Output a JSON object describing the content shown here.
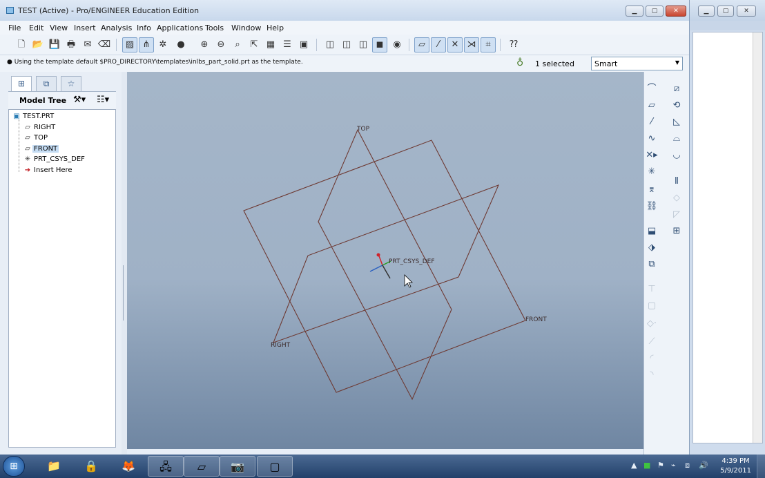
{
  "window": {
    "title": "TEST (Active) - Pro/ENGINEER Education Edition",
    "controls": {
      "minimize": "▁",
      "maximize": "▢",
      "close": "✕"
    }
  },
  "menu": [
    "File",
    "Edit",
    "View",
    "Insert",
    "Analysis",
    "Info",
    "Applications",
    "Tools",
    "Window",
    "Help"
  ],
  "toolbar_icons": [
    "new-icon",
    "open-icon",
    "save-icon",
    "print-icon",
    "send-icon",
    "erase-icon",
    "repaint-icon",
    "datum-display-icon",
    "spin-center-icon",
    "appearance-icon",
    "zoom-in-icon",
    "zoom-out-icon",
    "refit-icon",
    "reorient-icon",
    "saved-views-icon",
    "layers-icon",
    "view-manager-icon",
    "wireframe-icon",
    "hidden-line-icon",
    "no-hidden-icon",
    "shading-icon",
    "enhanced-realism-icon",
    "datum-planes-icon",
    "datum-axes-icon",
    "datum-points-icon",
    "coordinate-systems-icon",
    "annotations-icon",
    "context-help-icon"
  ],
  "status": {
    "message": "Using the template default $PRO_DIRECTORY\\templates\\inlbs_part_solid.prt as the template.",
    "selected": "1 selected",
    "filter": "Smart"
  },
  "model_tree": {
    "header": "Model Tree",
    "items": [
      {
        "label": "TEST.PRT",
        "icon": "part-icon"
      },
      {
        "label": "RIGHT",
        "icon": "datum-plane-icon"
      },
      {
        "label": "TOP",
        "icon": "datum-plane-icon"
      },
      {
        "label": "FRONT",
        "icon": "datum-plane-icon",
        "highlighted": true
      },
      {
        "label": "PRT_CSYS_DEF",
        "icon": "csys-icon"
      },
      {
        "label": "Insert Here",
        "icon": "insert-arrow-icon"
      }
    ]
  },
  "viewport": {
    "labels": {
      "top": "TOP",
      "front": "FRONT",
      "right": "RIGHT",
      "csys": "PRT_CSYS_DEF"
    },
    "datum_color": "#8a3b2e"
  },
  "taskbar": {
    "apps": [
      "windows-explorer-icon",
      "lock-icon",
      "firefox-icon",
      "network-icon",
      "notepad-icon",
      "camera-icon",
      "proe-icon"
    ],
    "time": "4:39 PM",
    "date": "5/9/2011"
  }
}
